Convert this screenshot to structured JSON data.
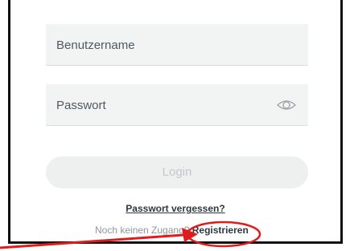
{
  "form": {
    "username_placeholder": "Benutzername",
    "password_placeholder": "Passwort",
    "password_toggle_icon": "eye-icon",
    "login_label": "Login",
    "forgot_password_label": "Passwort vergessen?",
    "no_account_text": "Noch keinen Zugang? ",
    "register_label": "Registrieren"
  },
  "annotation": {
    "color": "#e01b1b",
    "arrow_icon": "arrow-icon",
    "highlight_shape": "circle"
  }
}
